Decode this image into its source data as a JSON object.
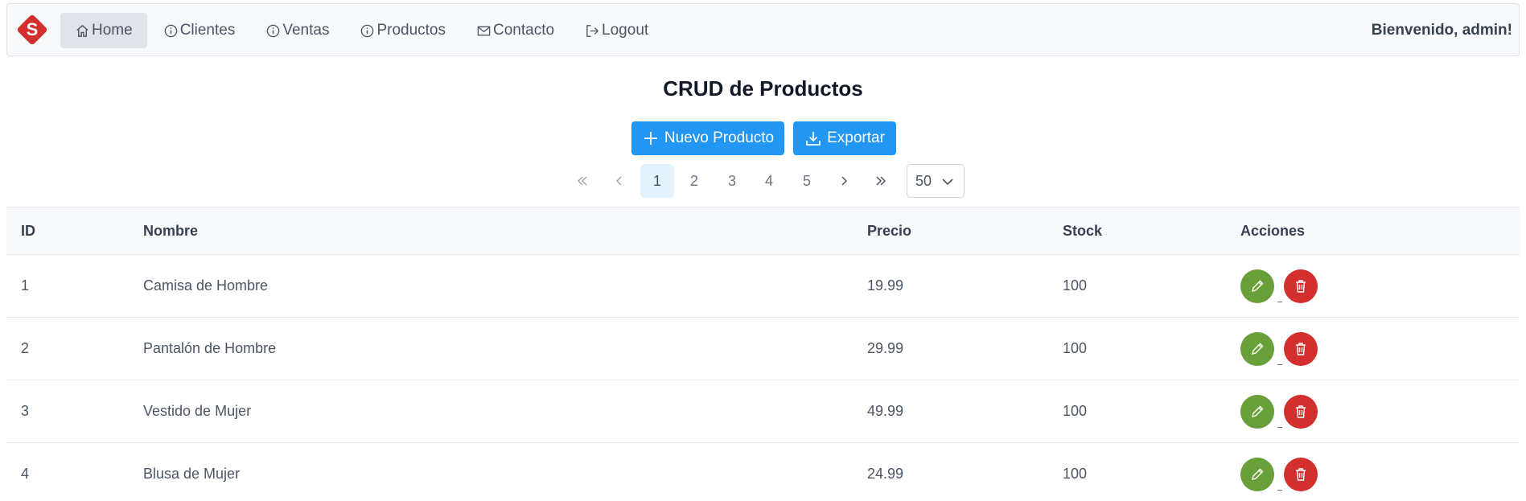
{
  "navbar": {
    "logo_letter": "S",
    "items": [
      {
        "label": "Home",
        "icon": "home-icon"
      },
      {
        "label": "Clientes",
        "icon": "info-icon"
      },
      {
        "label": "Ventas",
        "icon": "info-icon"
      },
      {
        "label": "Productos",
        "icon": "info-icon"
      },
      {
        "label": "Contacto",
        "icon": "envelope-icon"
      },
      {
        "label": "Logout",
        "icon": "logout-icon"
      }
    ],
    "welcome": "Bienvenido, admin!"
  },
  "page": {
    "title": "CRUD de Productos",
    "new_button": "Nuevo Producto",
    "export_button": "Exportar"
  },
  "pagination": {
    "pages": [
      "1",
      "2",
      "3",
      "4",
      "5"
    ],
    "current": "1",
    "rows_per_page": "50"
  },
  "table": {
    "headers": {
      "id": "ID",
      "name": "Nombre",
      "price": "Precio",
      "stock": "Stock",
      "actions": "Acciones"
    },
    "rows": [
      {
        "id": "1",
        "name": "Camisa de Hombre",
        "price": "19.99",
        "stock": "100"
      },
      {
        "id": "2",
        "name": "Pantalón de Hombre",
        "price": "29.99",
        "stock": "100"
      },
      {
        "id": "3",
        "name": "Vestido de Mujer",
        "price": "49.99",
        "stock": "100"
      },
      {
        "id": "4",
        "name": "Blusa de Mujer",
        "price": "24.99",
        "stock": "100"
      }
    ]
  },
  "colors": {
    "primary": "#2196f3",
    "edit": "#689f38",
    "delete": "#d32f2f",
    "logo": "#d32f2f"
  }
}
